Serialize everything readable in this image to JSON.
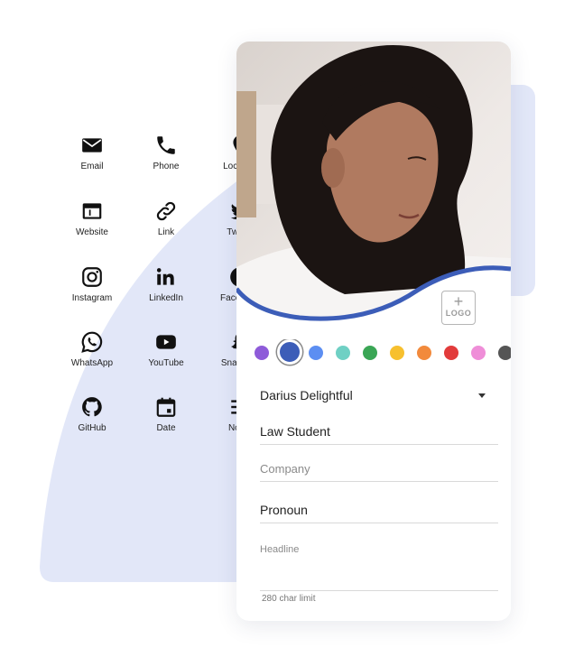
{
  "fields": [
    {
      "label": "Email",
      "icon": "email-icon"
    },
    {
      "label": "Phone",
      "icon": "phone-icon"
    },
    {
      "label": "Location",
      "icon": "location-icon"
    },
    {
      "label": "Website",
      "icon": "website-icon"
    },
    {
      "label": "Link",
      "icon": "link-icon"
    },
    {
      "label": "Twitter",
      "icon": "twitter-icon"
    },
    {
      "label": "Instagram",
      "icon": "instagram-icon"
    },
    {
      "label": "LinkedIn",
      "icon": "linkedin-icon"
    },
    {
      "label": "Facebook",
      "icon": "facebook-icon"
    },
    {
      "label": "WhatsApp",
      "icon": "whatsapp-icon"
    },
    {
      "label": "YouTube",
      "icon": "youtube-icon"
    },
    {
      "label": "Snapchat",
      "icon": "snapchat-icon"
    },
    {
      "label": "GitHub",
      "icon": "github-icon"
    },
    {
      "label": "Date",
      "icon": "calendar-icon"
    },
    {
      "label": "Notes",
      "icon": "notes-icon"
    }
  ],
  "card": {
    "logo_label": "LOGO",
    "logo_plus": "+",
    "wave_color": "#3c5db8",
    "colors": [
      "#8e5bd9",
      "#3c5db8",
      "#5c8ef2",
      "#6fd0c4",
      "#3aa655",
      "#f7c02e",
      "#f28a3c",
      "#e23b3b",
      "#ef8ed8",
      "#555555"
    ],
    "selected_color_index": 1,
    "name": "Darius Delightful",
    "title": "Law Student",
    "company_placeholder": "Company",
    "pronoun": "Pronoun",
    "headline_placeholder": "Headline",
    "char_limit": "280 char limit"
  }
}
